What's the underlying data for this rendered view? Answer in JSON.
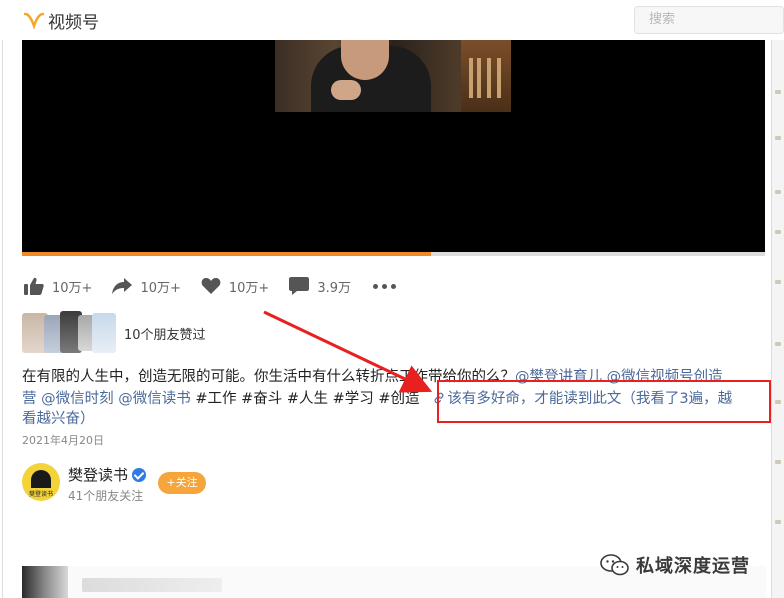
{
  "app": {
    "name": "视频号",
    "brand_color": "#f5a623"
  },
  "search": {
    "placeholder": "搜索"
  },
  "video": {
    "progress_percent": 55,
    "progress_color": "#f08a24"
  },
  "actions": [
    {
      "icon": "thumb-up-icon",
      "label": "10万+"
    },
    {
      "icon": "share-icon",
      "label": "10万+"
    },
    {
      "icon": "heart-icon",
      "label": "10万+"
    },
    {
      "icon": "comment-icon",
      "label": "3.9万"
    }
  ],
  "liked": {
    "text": "10个朋友赞过"
  },
  "post": {
    "line1_text": "在有限的人生中，创造无限的可能。你生活中有什么转折点工作带给你的么？",
    "mention1": "@樊登讲育儿",
    "mention2": "@微信视频号创造",
    "line2_prefix": "营",
    "mention3": "@微信时刻",
    "mention4": "@微信读书",
    "tags": "#工作 #奋斗 #人生 #学习 #创造",
    "link_text": "该有多好命，才能读到此文（我看了3遍，越",
    "link_text_cont": "看越兴奋）",
    "date": "2021年4月20日"
  },
  "account": {
    "name": "樊登读书",
    "followers": "41个朋友关注",
    "follow_label": "+关注",
    "logo_text": "樊登读书"
  },
  "watermark": {
    "text": "私域深度运营"
  },
  "colors": {
    "highlight_box": "#e82020",
    "link": "#4b6a9b"
  }
}
